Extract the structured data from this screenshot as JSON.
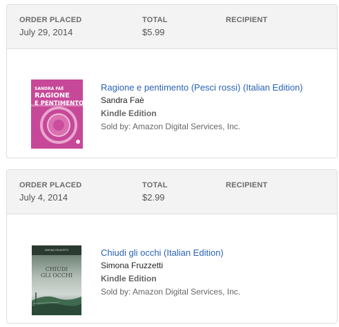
{
  "orders": [
    {
      "header": {
        "placed_label": "ORDER PLACED",
        "placed_value": "July 29, 2014",
        "total_label": "TOTAL",
        "total_value": "$5.99",
        "recipient_label": "RECIPIENT"
      },
      "item": {
        "title": "Ragione e pentimento (Pesci rossi) (Italian Edition)",
        "author": "Sandra Faè",
        "format": "Kindle Edition",
        "seller": "Sold by: Amazon Digital Services, Inc.",
        "cover": {
          "author_text": "SANDRA FAÈ",
          "title_line1": "RAGIONE",
          "title_line2": "E PENTIMENTO",
          "color": "#d04f9e"
        }
      }
    },
    {
      "header": {
        "placed_label": "ORDER PLACED",
        "placed_value": "July 4, 2014",
        "total_label": "TOTAL",
        "total_value": "$2.99",
        "recipient_label": "RECIPIENT"
      },
      "item": {
        "title": "Chiudi gli occhi (Italian Edition)",
        "author": "Simona Fruzzetti",
        "format": "Kindle Edition",
        "seller": "Sold by: Amazon Digital Services, Inc.",
        "cover": {
          "author_text": "SIMONA FRUZZETTI",
          "title_line1": "CHIUDI",
          "title_line2": "GLI OCCHI",
          "color": "#2c4a3c"
        }
      }
    }
  ],
  "colors": {
    "link": "#2962b3",
    "header_bg": "#f3f3f3",
    "border": "#dddddd"
  }
}
